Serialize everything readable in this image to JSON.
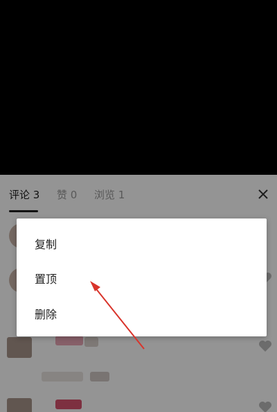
{
  "tabs": [
    {
      "label": "评论 3"
    },
    {
      "label": "赞 0"
    },
    {
      "label": "浏览 1"
    }
  ],
  "menu": {
    "items": [
      {
        "label": "复制"
      },
      {
        "label": "置顶"
      },
      {
        "label": "删除"
      }
    ]
  },
  "colors": {
    "annotation_arrow": "#d9342b",
    "active_tab": "#222222",
    "inactive_tab": "#999999"
  }
}
